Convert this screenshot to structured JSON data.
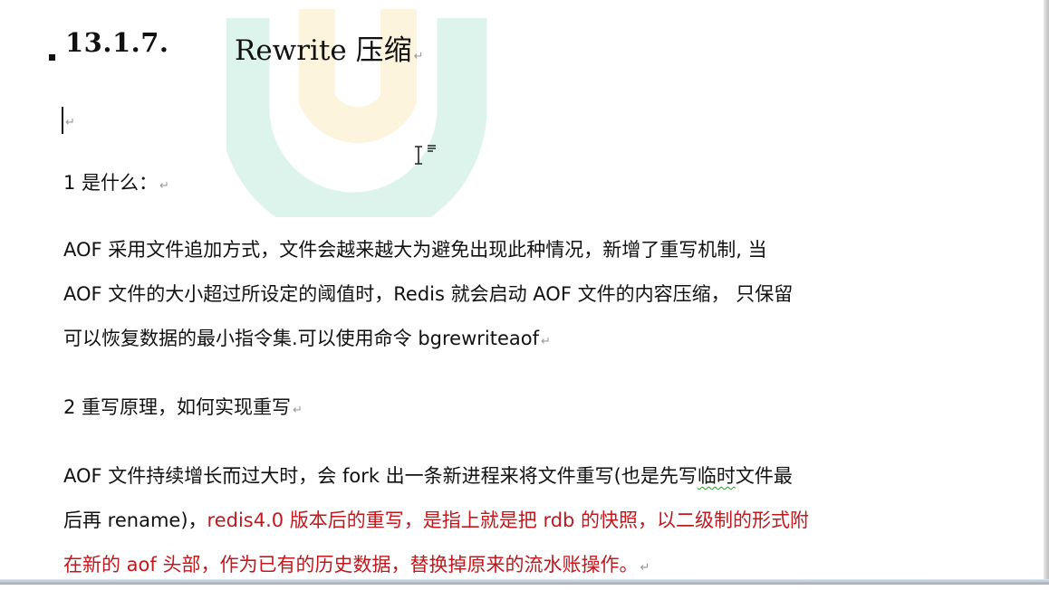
{
  "heading": {
    "number": "13.1.7.",
    "title": "Rewrite 压缩",
    "pilcrow": "↵"
  },
  "section1": {
    "label": "1 是什么：",
    "line1": "AOF 采用文件追加方式，文件会越来越大为避免出现此种情况，新增了重写机制, 当",
    "line2": "AOF 文件的大小超过所设定的阈值时，Redis 就会启动 AOF 文件的内容压缩， 只保留",
    "line3": "可以恢复数据的最小指令集.可以使用命令 bgrewriteaof"
  },
  "section2": {
    "label": "2 重写原理，如何实现重写",
    "line1_pre": "AOF 文件持续增长而过大时，会 fork 出一条新进程来将文件重写(也是先写",
    "line1_wavy": "临时",
    "line1_post": "文件最",
    "line2_black": "后再 rename)，",
    "line2_red": "redis4.0 版本后的重写，是指上就是把 rdb  的快照，以二级制的形式附",
    "line3_red": "在新的 aof 头部，作为已有的历史数据，替换掉原来的流水账操作。"
  },
  "colors": {
    "text": "#111111",
    "highlight_red": "#c0181c",
    "spell_underline": "#2e9b2e",
    "watermark_green": "#2fbf8f",
    "watermark_yellow": "#f3c23a"
  },
  "icons": [
    "text-cursor-icon",
    "ibeam-cursor-icon",
    "paragraph-mark-icon",
    "watermark-logo-icon"
  ]
}
